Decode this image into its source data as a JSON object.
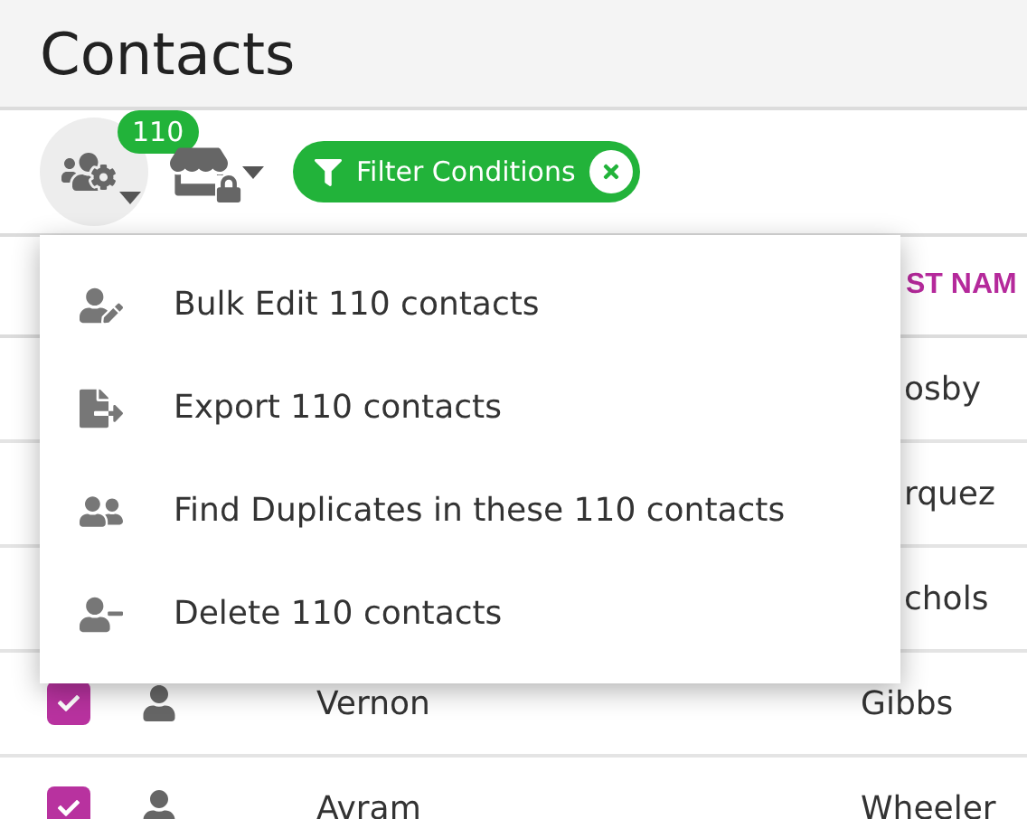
{
  "title": "Contacts",
  "toolbar": {
    "selection_count": "110",
    "filter_chip": {
      "label": "Filter Conditions"
    }
  },
  "table": {
    "columns": [
      {
        "label": "ST NAM"
      }
    ],
    "rows": [
      {
        "last_name": "osby"
      },
      {
        "last_name": "rquez"
      },
      {
        "last_name": "chols"
      },
      {
        "checked": true,
        "first_name": "Vernon",
        "last_name": "Gibbs"
      },
      {
        "checked": true,
        "first_name": "Avram",
        "last_name": "Wheeler"
      }
    ]
  },
  "menu": {
    "items": [
      {
        "kind": "edit",
        "label": "Bulk Edit 110 contacts"
      },
      {
        "kind": "export",
        "label": "Export 110 contacts"
      },
      {
        "kind": "duplicates",
        "label": "Find Duplicates in these 110 contacts"
      },
      {
        "kind": "delete",
        "label": "Delete 110 contacts"
      }
    ]
  }
}
